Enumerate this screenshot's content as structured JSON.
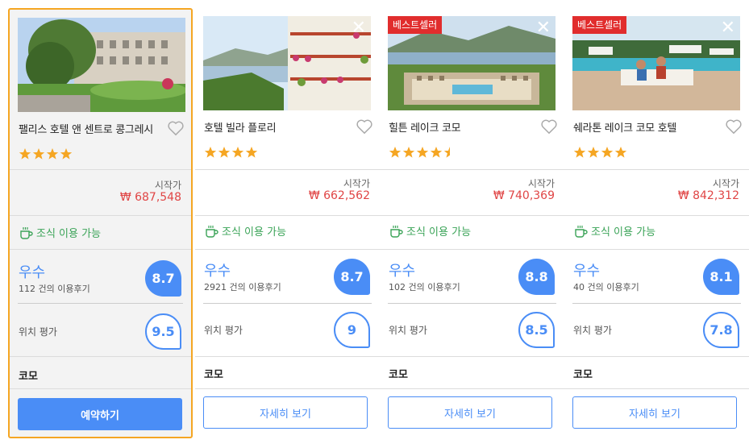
{
  "hotels": [
    {
      "name": "팰리스 호텔 앤 센트로 콩그레시",
      "badge": "",
      "show_close": false,
      "stars": 4,
      "from_label": "시작가",
      "price": "₩ 687,548",
      "breakfast": "조식 이용 가능",
      "rating_label": "우수",
      "reviews": "112 건의 이용후기",
      "score": "8.7",
      "location_label": "위치 평가",
      "location_score": "9.5",
      "city": "코모",
      "button": "예약하기",
      "selected": true
    },
    {
      "name": "호텔 빌라 플로리",
      "badge": "",
      "show_close": true,
      "stars": 4,
      "from_label": "시작가",
      "price": "₩ 662,562",
      "breakfast": "조식 이용 가능",
      "rating_label": "우수",
      "reviews": "2921 건의 이용후기",
      "score": "8.7",
      "location_label": "위치 평가",
      "location_score": "9",
      "city": "코모",
      "button": "자세히 보기",
      "selected": false
    },
    {
      "name": "힐튼 레이크 코모",
      "badge": "베스트셀러",
      "show_close": true,
      "stars": 4.5,
      "from_label": "시작가",
      "price": "₩ 740,369",
      "breakfast": "조식 이용 가능",
      "rating_label": "우수",
      "reviews": "102 건의 이용후기",
      "score": "8.8",
      "location_label": "위치 평가",
      "location_score": "8.5",
      "city": "코모",
      "button": "자세히 보기",
      "selected": false
    },
    {
      "name": "쉐라톤 레이크 코모 호텔",
      "badge": "베스트셀러",
      "show_close": true,
      "stars": 4,
      "from_label": "시작가",
      "price": "₩ 842,312",
      "breakfast": "조식 이용 가능",
      "rating_label": "우수",
      "reviews": "40 건의 이용후기",
      "score": "8.1",
      "location_label": "위치 평가",
      "location_score": "7.8",
      "city": "코모",
      "button": "자세히 보기",
      "selected": false
    }
  ],
  "close_glyph": "✕",
  "colors": {
    "accent": "#4a8df6",
    "price": "#e04545",
    "breakfast": "#3aa357",
    "badge": "#e12d2d",
    "selected_border": "#f5a623",
    "star": "#f5a623"
  }
}
